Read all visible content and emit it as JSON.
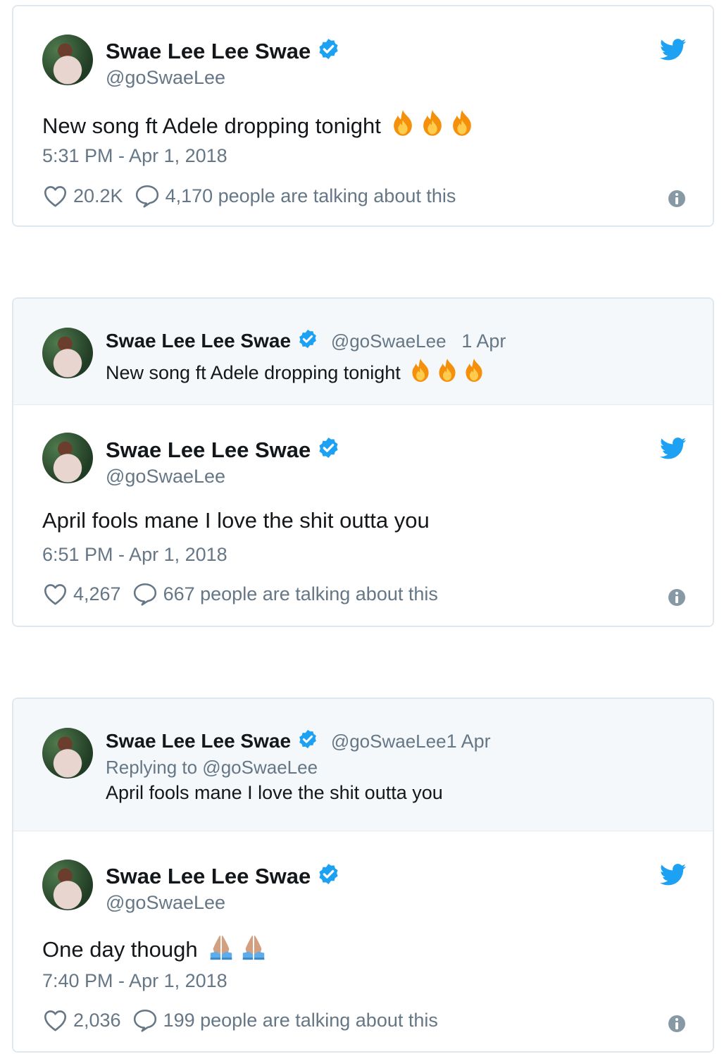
{
  "tweets": [
    {
      "author_name": "Swae Lee Lee Swae",
      "author_handle": "@goSwaeLee",
      "text": "New song ft Adele dropping tonight",
      "text_emoji": "fire-emoji x3",
      "timestamp": "5:31 PM - Apr 1, 2018",
      "likes": "20.2K",
      "talking": "4,170 people are talking about this"
    },
    {
      "quoted": {
        "author_name": "Swae Lee Lee Swae",
        "author_handle": "@goSwaeLee",
        "date": "1 Apr",
        "text": "New song ft Adele dropping tonight",
        "text_emoji": "fire-emoji x3"
      },
      "author_name": "Swae Lee Lee Swae",
      "author_handle": "@goSwaeLee",
      "text": "April fools mane I love the shit outta you",
      "timestamp": "6:51 PM - Apr 1, 2018",
      "likes": "4,267",
      "talking": "667 people are talking about this"
    },
    {
      "quoted": {
        "author_name": "Swae Lee Lee Swae",
        "author_handle": "@goSwaeLee",
        "date": "1 Apr",
        "replying_to": "Replying to @goSwaeLee",
        "text": "April fools mane I love the shit outta you"
      },
      "author_name": "Swae Lee Lee Swae",
      "author_handle": "@goSwaeLee",
      "text": "One day though",
      "text_emoji": "folded-hands-emoji x2",
      "timestamp": "7:40 PM - Apr 1, 2018",
      "likes": "2,036",
      "talking": "199 people are talking about this"
    }
  ],
  "colors": {
    "twitter_blue": "#1da1f2",
    "secondary_text": "#657786",
    "border": "#e1e8ed",
    "quote_background": "#f5f8fa"
  }
}
